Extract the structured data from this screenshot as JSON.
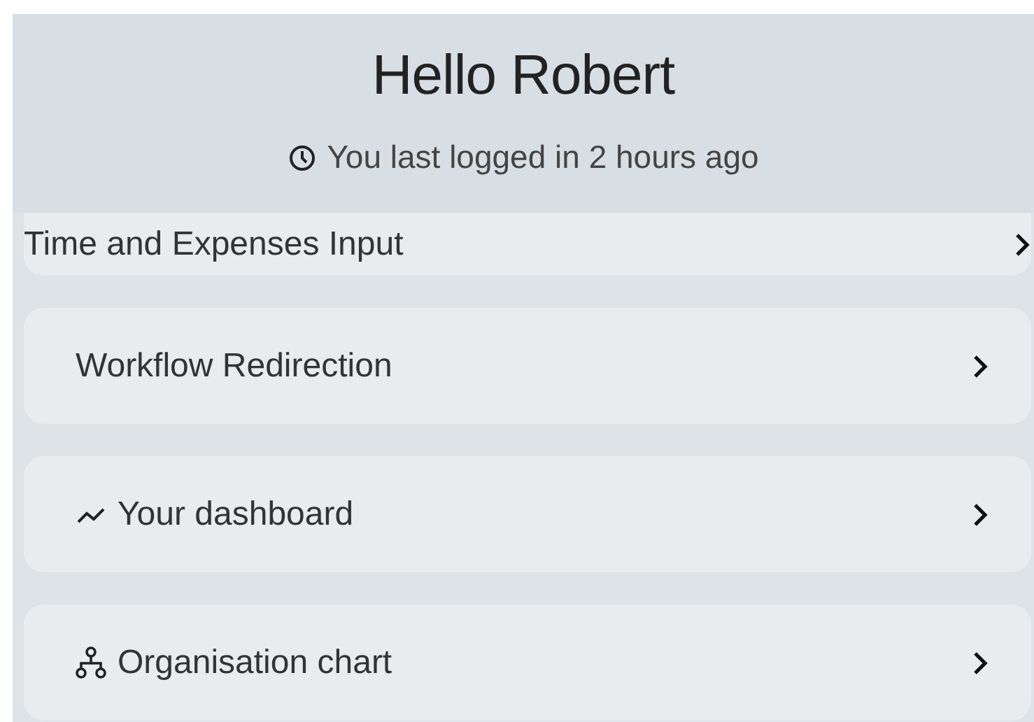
{
  "header": {
    "title": "Hello Robert",
    "last_login": "You last logged in 2 hours ago"
  },
  "menu": [
    {
      "label": "Time and Expenses Input",
      "kind": "plain"
    },
    {
      "label": "Workflow Redirection",
      "kind": "plain"
    },
    {
      "label": "Your dashboard",
      "kind": "trend"
    },
    {
      "label": "Organisation chart",
      "kind": "org"
    }
  ]
}
